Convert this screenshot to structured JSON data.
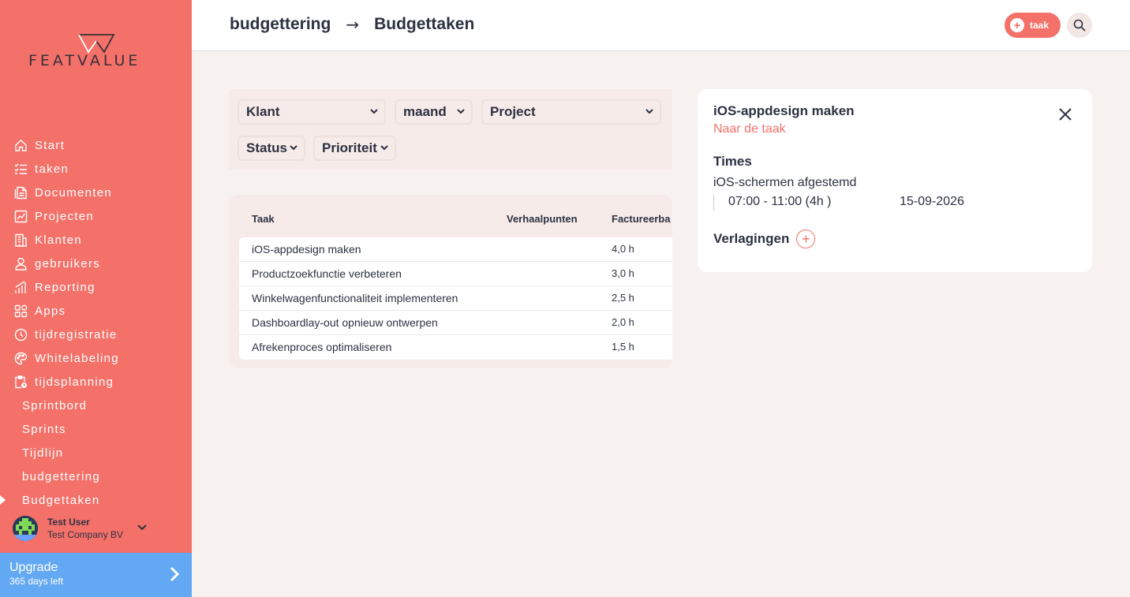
{
  "brand": {
    "logo_text": "FEATVALUE",
    "color": "#f4716a"
  },
  "sidebar": {
    "items": [
      {
        "label": "Start",
        "icon": "home-icon"
      },
      {
        "label": "taken",
        "icon": "checklist-icon"
      },
      {
        "label": "Documenten",
        "icon": "document-icon"
      },
      {
        "label": "Projecten",
        "icon": "chart-icon"
      },
      {
        "label": "Klanten",
        "icon": "building-icon"
      },
      {
        "label": "gebruikers",
        "icon": "user-icon"
      },
      {
        "label": "Reporting",
        "icon": "bar-chart-icon"
      },
      {
        "label": "Apps",
        "icon": "apps-icon"
      },
      {
        "label": "tijdregistratie",
        "icon": "timer-icon"
      },
      {
        "label": "Whitelabeling",
        "icon": "palette-icon"
      },
      {
        "label": "tijdsplanning",
        "icon": "clipboard-clock-icon"
      }
    ],
    "sub_items": [
      {
        "label": "Sprintbord"
      },
      {
        "label": "Sprints"
      },
      {
        "label": "Tijdlijn"
      },
      {
        "label": "budgettering"
      },
      {
        "label": "Budgettaken",
        "active": true
      }
    ],
    "user": {
      "name": "Test User",
      "company": "Test Company BV"
    },
    "upgrade": {
      "title": "Upgrade",
      "subtitle": "365 days left",
      "color": "#63a8f2"
    }
  },
  "header": {
    "breadcrumb": {
      "parent": "budgettering",
      "arrow": "→",
      "current": "Budgettaken"
    },
    "add_button_label": "taak"
  },
  "filters": {
    "klant": "Klant",
    "maand": "maand",
    "project": "Project",
    "status": "Status",
    "prioriteit": "Prioriteit"
  },
  "table": {
    "columns": [
      "Taak",
      "Verhaalpunten",
      "Factureerba"
    ],
    "rows": [
      {
        "taak": "iOS-appdesign maken",
        "verhaalpunten": "",
        "factureerbaar": "4,0 h"
      },
      {
        "taak": "Productzoekfunctie verbeteren",
        "verhaalpunten": "",
        "factureerbaar": "3,0 h"
      },
      {
        "taak": "Winkelwagenfunctionaliteit implementeren",
        "verhaalpunten": "",
        "factureerbaar": "2,5 h"
      },
      {
        "taak": "Dashboardlay-out opnieuw ontwerpen",
        "verhaalpunten": "",
        "factureerbaar": "2,0 h"
      },
      {
        "taak": "Afrekenproces optimaliseren",
        "verhaalpunten": "",
        "factureerbaar": "1,5 h"
      }
    ]
  },
  "detail": {
    "title": "iOS-appdesign maken",
    "link": "Naar de taak",
    "times_heading": "Times",
    "entry_title": "iOS-schermen afgestemd",
    "entry_time": "07:00 - 11:00 (4h )",
    "entry_date": "15-09-2026",
    "verlagingen": "Verlagingen"
  }
}
